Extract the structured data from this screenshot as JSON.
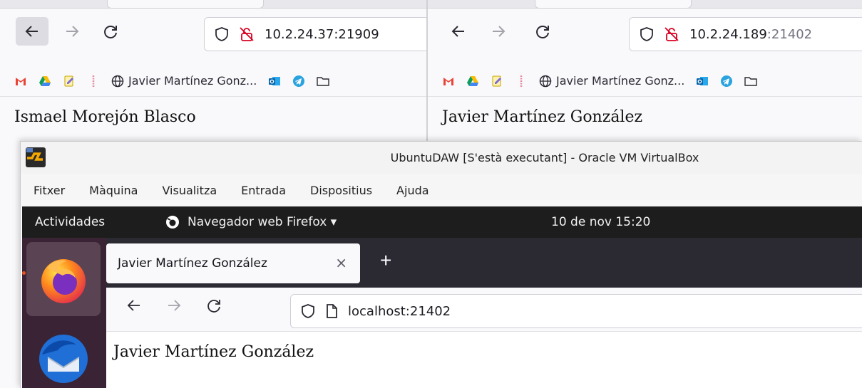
{
  "left_browser": {
    "url": "10.2.24.37:21909",
    "bookmarks": {
      "profile_label": "Javier Martínez Gonz..."
    },
    "page_heading": "Ismael Morejón Blasco"
  },
  "right_browser": {
    "url_host": "10.2.24.189",
    "url_port": ":21402",
    "bookmarks": {
      "profile_label": "Javier Martínez Gonz..."
    },
    "page_heading": "Javier Martínez González"
  },
  "virtualbox": {
    "title": "UbuntuDAW [S'està executant] - Oracle VM VirtualBox",
    "menu": [
      "Fitxer",
      "Màquina",
      "Visualitza",
      "Entrada",
      "Dispositius",
      "Ajuda"
    ]
  },
  "ubuntu": {
    "activities_label": "Actividades",
    "app_menu_label": "Navegador web Firefox ▾",
    "clock": "10 de nov  15:20",
    "dock_apps": [
      "firefox-icon",
      "thunderbird-icon"
    ]
  },
  "firefox_guest": {
    "tab_title": "Javier Martínez González",
    "tab_close": "×",
    "new_tab": "+",
    "url": "localhost:21402",
    "page_heading": "Javier Martínez González"
  },
  "colors": {
    "accent_orange": "#e95420",
    "dock_bg": "#3a2334",
    "topbar_bg": "#1d1d1d",
    "firefox_tabbar": "#2b2a33",
    "insecure_red": "#d70022"
  }
}
